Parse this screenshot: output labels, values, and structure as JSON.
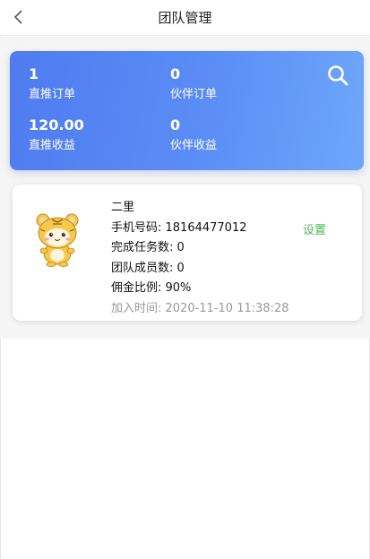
{
  "nav": {
    "title": "团队管理"
  },
  "stats": [
    {
      "value": "1",
      "label": "直推订单"
    },
    {
      "value": "0",
      "label": "伙伴订单"
    },
    {
      "value": "120.00",
      "label": "直推收益"
    },
    {
      "value": "0",
      "label": "伙伴收益"
    }
  ],
  "member": {
    "name": "二里",
    "phone": "手机号码: 18164477012",
    "tasks": "完成任务数: 0",
    "team": "团队成员数: 0",
    "commission": "佣金比例: 90%",
    "joined": "加入时间:  2020-11-10 11:38:28",
    "settings_label": "设置"
  },
  "colors": {
    "card_gradient_start": "#4f7bf0",
    "card_gradient_end": "#6ea7fb",
    "settings": "#52b556"
  }
}
